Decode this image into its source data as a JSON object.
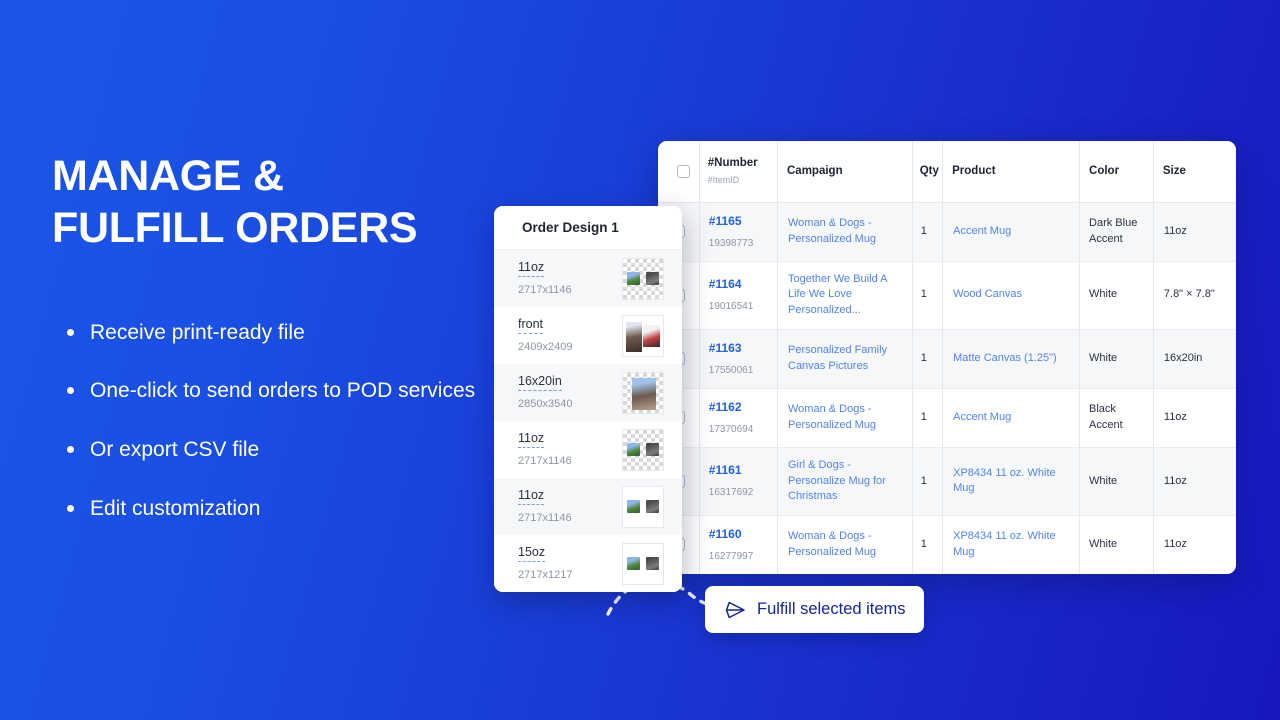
{
  "theme": {
    "bg_gradient_from": "#1b56e8",
    "bg_gradient_to": "#1817be",
    "link_blue": "#5283ef",
    "number_blue": "#1f62e8",
    "button_text": "#16269c"
  },
  "hero": {
    "headline_line1": "MANAGE &",
    "headline_line2": "FULFILL ORDERS",
    "bullets": [
      {
        "text": "Receive print-ready file"
      },
      {
        "text": "One-click to send orders to POD services"
      },
      {
        "text": "Or export CSV file"
      },
      {
        "text": "Edit customization"
      }
    ]
  },
  "design_panel": {
    "title": "Order Design 1",
    "rows": [
      {
        "label": "11oz",
        "dims": "2717x1146",
        "thumb": "checker-two-art"
      },
      {
        "label": "front",
        "dims": "2409x2409",
        "thumb": "poster-couple"
      },
      {
        "label": "16x20in",
        "dims": "2850x3540",
        "thumb": "checker-portrait"
      },
      {
        "label": "11oz",
        "dims": "2717x1146",
        "thumb": "checker-two-art"
      },
      {
        "label": "11oz",
        "dims": "2717x1146",
        "thumb": "white-two-art"
      },
      {
        "label": "15oz",
        "dims": "2717x1217",
        "thumb": "white-two-art"
      }
    ]
  },
  "orders_table": {
    "columns": {
      "checkbox": "",
      "number_main": "#Number",
      "number_sub": "#ItemID",
      "campaign": "Campaign",
      "qty": "Qty",
      "product": "Product",
      "color": "Color",
      "size": "Size"
    },
    "rows": [
      {
        "number": "#1165",
        "item_id": "19398773",
        "campaign": "Woman & Dogs - Personalized Mug",
        "qty": "1",
        "product": "Accent Mug",
        "color": "Dark Blue Accent",
        "size": "11oz"
      },
      {
        "number": "#1164",
        "item_id": "19016541",
        "campaign": "Together We Build A Life We Love Personalized...",
        "qty": "1",
        "product": "Wood Canvas",
        "color": "White",
        "size": "7.8\" × 7.8\""
      },
      {
        "number": "#1163",
        "item_id": "17550061",
        "campaign": "Personalized Family Canvas Pictures",
        "qty": "1",
        "product": "Matte Canvas (1.25\")",
        "color": "White",
        "size": "16x20in"
      },
      {
        "number": "#1162",
        "item_id": "17370694",
        "campaign": "Woman & Dogs - Personalized Mug",
        "qty": "1",
        "product": "Accent Mug",
        "color": "Black Accent",
        "size": "11oz"
      },
      {
        "number": "#1161",
        "item_id": "16317692",
        "campaign": "Girl & Dogs - Personalize Mug for Christmas",
        "qty": "1",
        "product": "XP8434 11 oz. White Mug",
        "color": "White",
        "size": "11oz"
      },
      {
        "number": "#1160",
        "item_id": "16277997",
        "campaign": "Woman & Dogs - Personalized Mug",
        "qty": "1",
        "product": "XP8434 11 oz. White Mug",
        "color": "White",
        "size": "11oz"
      }
    ]
  },
  "fulfill_button": {
    "label": "Fulfill selected items",
    "icon": "send-icon"
  }
}
